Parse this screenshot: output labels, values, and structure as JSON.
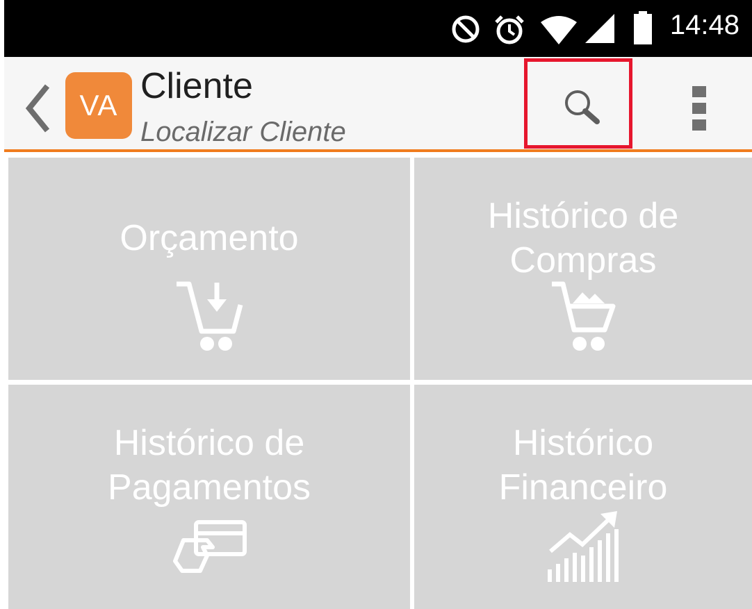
{
  "status_bar": {
    "time": "14:48",
    "icons": [
      "dnd-icon",
      "alarm-icon",
      "wifi-icon",
      "signal-icon",
      "battery-icon"
    ]
  },
  "action_bar": {
    "avatar_text": "VA",
    "title": "Cliente",
    "subtitle": "Localizar Cliente",
    "accent_color": "#f07c1e",
    "icons": [
      "back-arrow-icon",
      "search-icon",
      "overflow-menu-icon"
    ]
  },
  "tiles": [
    {
      "line1": "Orçamento",
      "line2": "",
      "icon": "cart-add-icon"
    },
    {
      "line1": "Histórico de",
      "line2": "Compras",
      "icon": "cart-full-icon"
    },
    {
      "line1": "Histórico de",
      "line2": "Pagamentos",
      "icon": "card-payment-icon"
    },
    {
      "line1": "Histórico",
      "line2": "Financeiro",
      "icon": "growth-chart-icon"
    }
  ],
  "colors": {
    "tile_bg": "#d6d6d6",
    "status_bg": "#000000",
    "highlight": "#e6162d"
  }
}
